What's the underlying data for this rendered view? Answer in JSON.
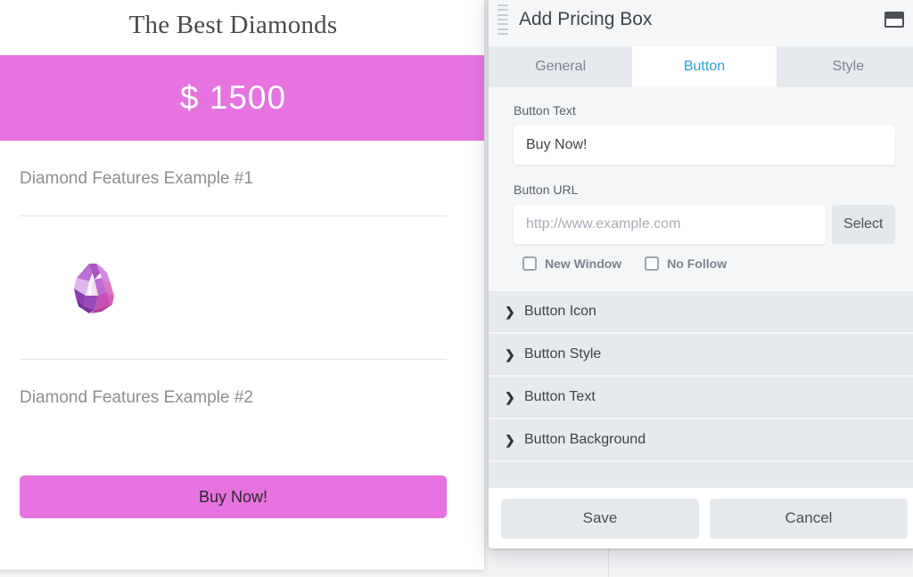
{
  "preview": {
    "title": "The Best Diamonds",
    "price": "$ 1500",
    "accent_color": "#e673e0",
    "features": [
      {
        "label": "Diamond Features Example #1",
        "icon": "gem-stone-icon"
      },
      {
        "label": "Diamond Features Example #2",
        "icon": ""
      }
    ],
    "cta_label": "Buy Now!"
  },
  "modal": {
    "title": "Add Pricing Box",
    "drag_handle_icon": "drag-handle-icon",
    "window_icon": "window-mode-icon",
    "tabs": [
      {
        "label": "General",
        "active": false
      },
      {
        "label": "Button",
        "active": true
      },
      {
        "label": "Style",
        "active": false
      }
    ],
    "active_tab_color": "#29a3dc",
    "fields": {
      "button_text": {
        "label": "Button Text",
        "value": "Buy Now!",
        "placeholder": ""
      },
      "button_url": {
        "label": "Button URL",
        "value": "",
        "placeholder": "http://www.example.com",
        "select_label": "Select"
      }
    },
    "checkboxes": [
      {
        "label": "New Window",
        "checked": false
      },
      {
        "label": "No Follow",
        "checked": false
      }
    ],
    "accordion": [
      {
        "label": "Button Icon",
        "icon": "chevron-right-icon"
      },
      {
        "label": "Button Style",
        "icon": "chevron-right-icon"
      },
      {
        "label": "Button Text",
        "icon": "chevron-right-icon"
      },
      {
        "label": "Button Background",
        "icon": "chevron-right-icon"
      }
    ],
    "footer": {
      "save_label": "Save",
      "cancel_label": "Cancel"
    }
  }
}
